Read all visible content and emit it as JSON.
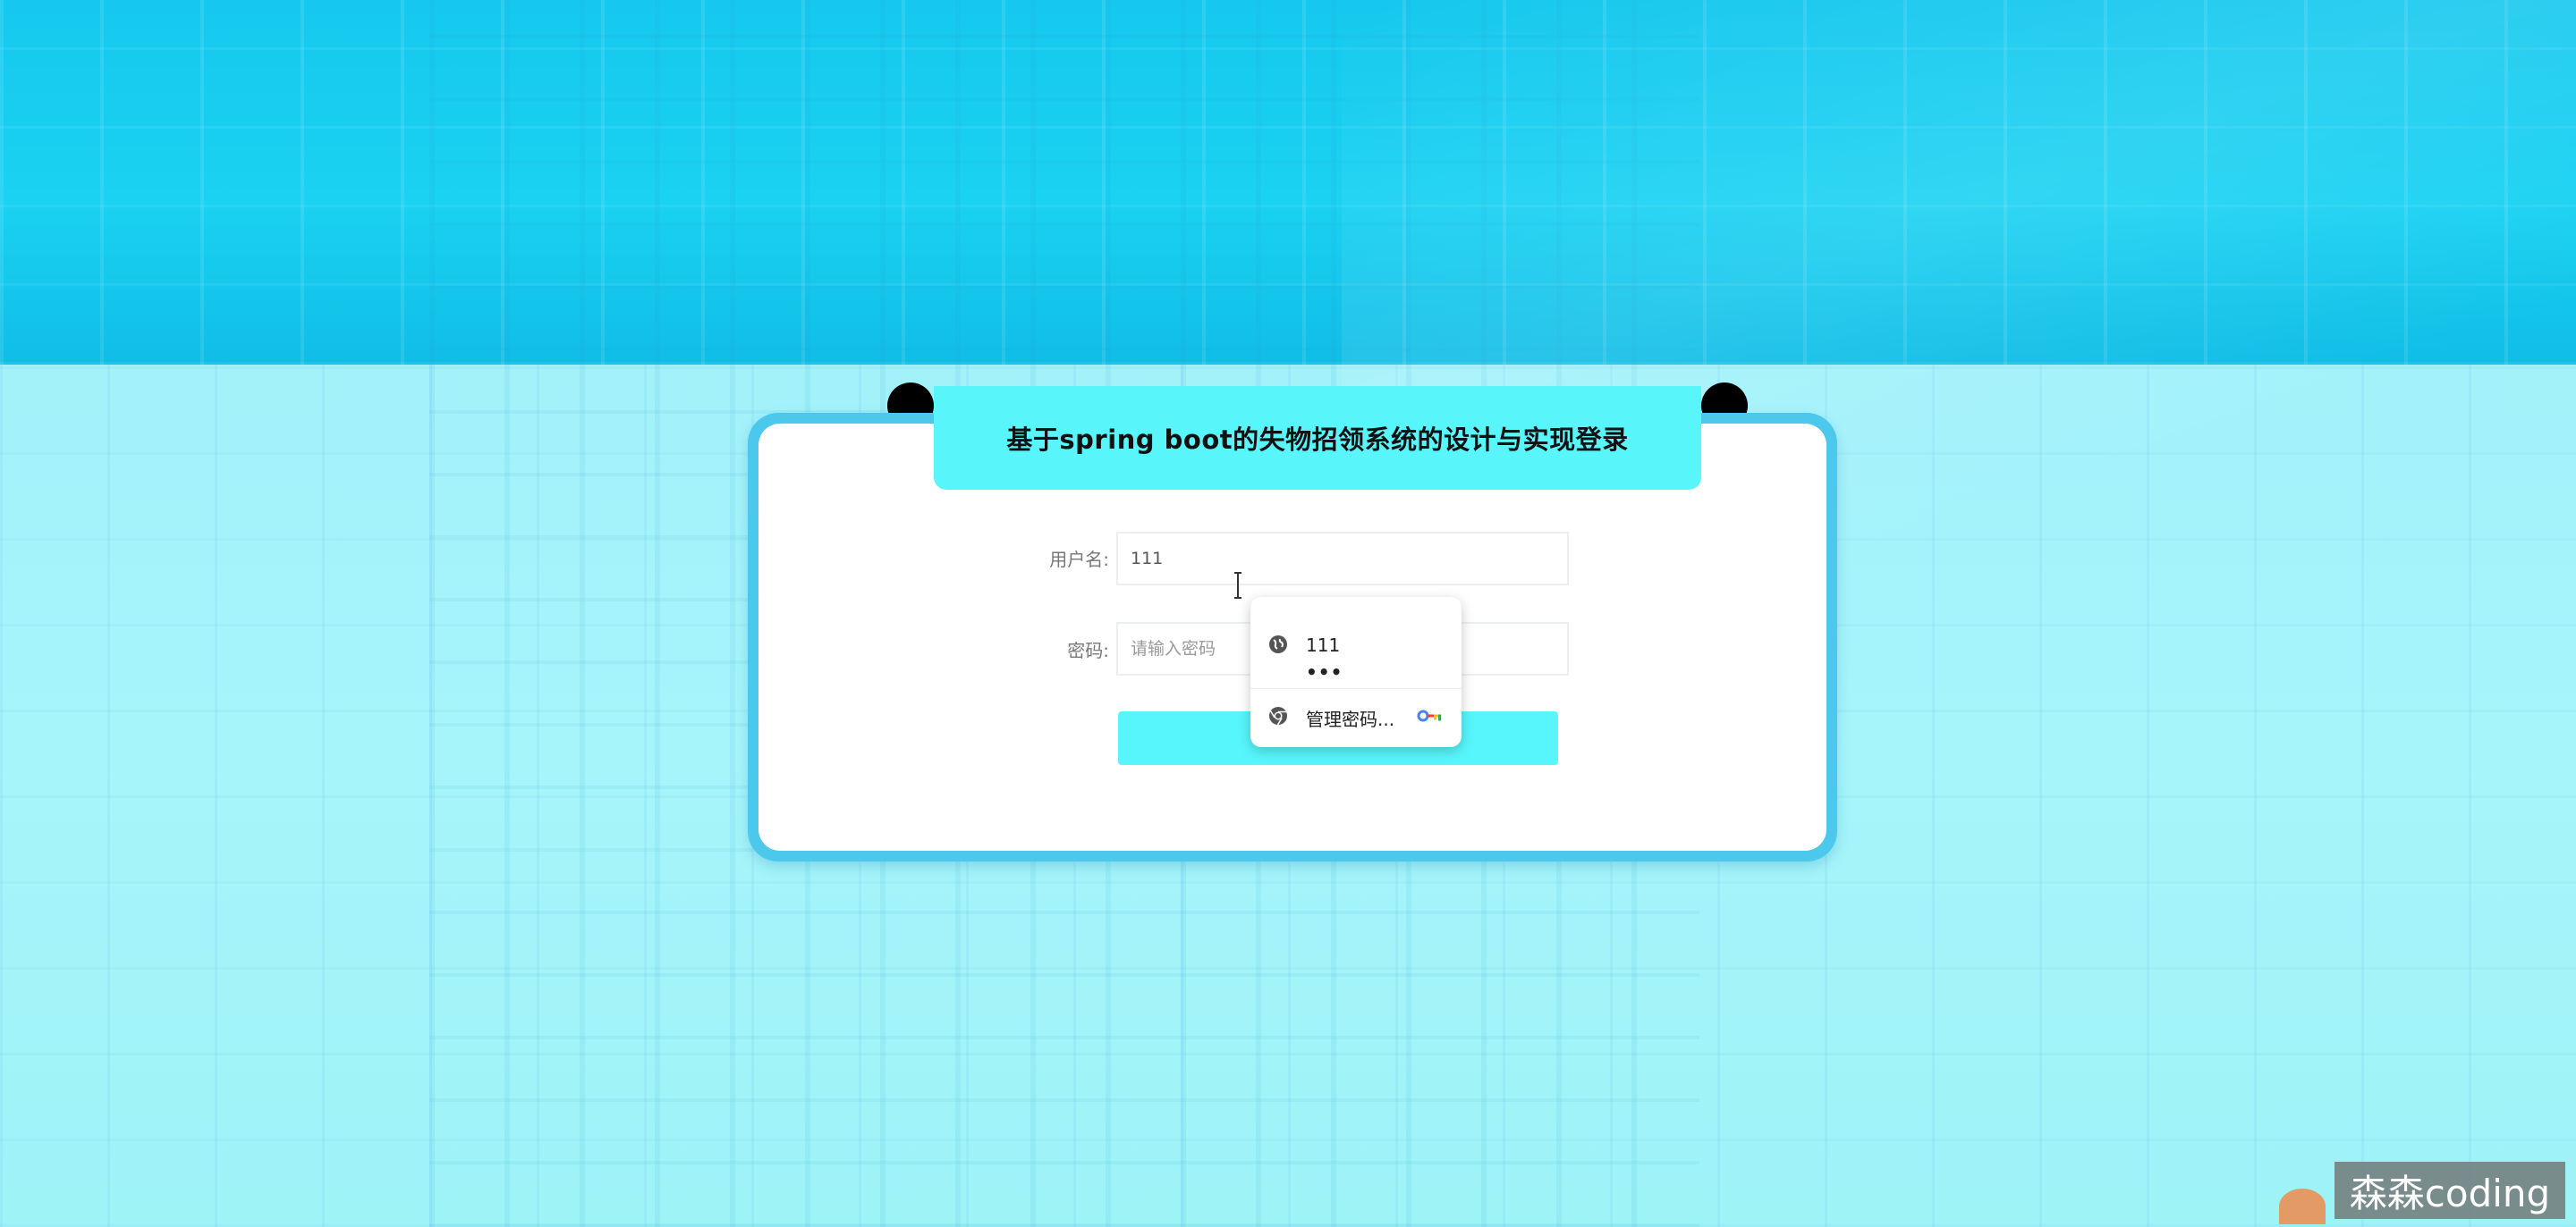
{
  "login": {
    "title": "基于spring boot的失物招领系统的设计与实现登录",
    "username_label": "用户名:",
    "username_value": "111",
    "password_label": "密码:",
    "password_placeholder": "请输入密码",
    "login_button_label": ""
  },
  "autofill": {
    "saved_username": "111",
    "saved_password_mask": "•••",
    "manage_label": "管理密码...",
    "site_icon": "globe-icon",
    "manage_icon": "chrome-icon",
    "key_icon": "google-key-icon"
  },
  "watermark": {
    "text": "森森coding"
  },
  "colors": {
    "accent": "#58f5fb",
    "card_border": "#4cc8ec",
    "background_top": "#16c8ee",
    "background_bottom": "#a6f5fb"
  }
}
